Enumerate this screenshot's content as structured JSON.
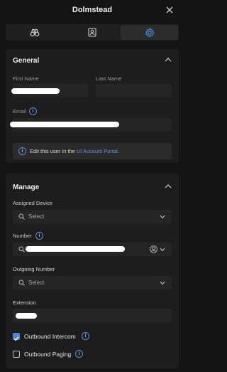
{
  "window": {
    "title": "Dolmstead"
  },
  "tabs": [
    {
      "icon": "binoculars-icon"
    },
    {
      "icon": "contact-card-icon"
    },
    {
      "icon": "gear-icon",
      "active": true
    }
  ],
  "general": {
    "title": "General",
    "first_name_label": "First Name",
    "last_name_label": "Last Name",
    "email_label": "Email",
    "notice_prefix": "Edit this user in the ",
    "notice_link": "UI Account Portal",
    "notice_suffix": "."
  },
  "manage": {
    "title": "Manage",
    "assigned_device_label": "Assigned Device",
    "assigned_device_placeholder": "Select",
    "number_label": "Number",
    "outgoing_number_label": "Outgoing Number",
    "outgoing_number_placeholder": "Select",
    "extension_label": "Extension",
    "outbound_intercom_label": "Outbound Intercom",
    "outbound_intercom_checked": true,
    "outbound_paging_label": "Outbound Paging",
    "outbound_paging_checked": false
  },
  "colors": {
    "accent": "#4a86d9",
    "link": "#5c92e6",
    "background": "#141414",
    "panel": "#1d1d1d"
  }
}
